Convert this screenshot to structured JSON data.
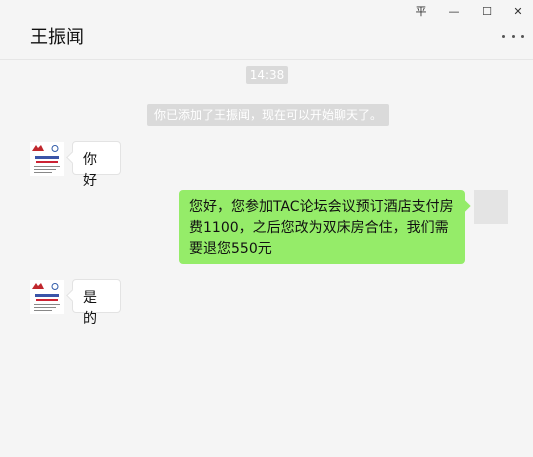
{
  "window": {
    "controls": {
      "pin": "平",
      "minimize": "—",
      "maximize": "☐",
      "close": "✕"
    }
  },
  "chat": {
    "title": "王振闻"
  },
  "messages": {
    "timestamp": "14:38",
    "system_notice": "你已添加了王振闻，现在可以开始聊天了。",
    "m1": {
      "sender": "contact",
      "text": "你好"
    },
    "m2": {
      "sender": "self",
      "text": "您好，您参加TAC论坛会议预订酒店支付房费1100，之后您改为双床房合住，我们需要退您550元"
    },
    "m3": {
      "sender": "contact",
      "text": "是的"
    }
  },
  "colors": {
    "self_bubble": "#95ec69",
    "contact_bubble": "#ffffff",
    "background": "#f5f5f5"
  }
}
